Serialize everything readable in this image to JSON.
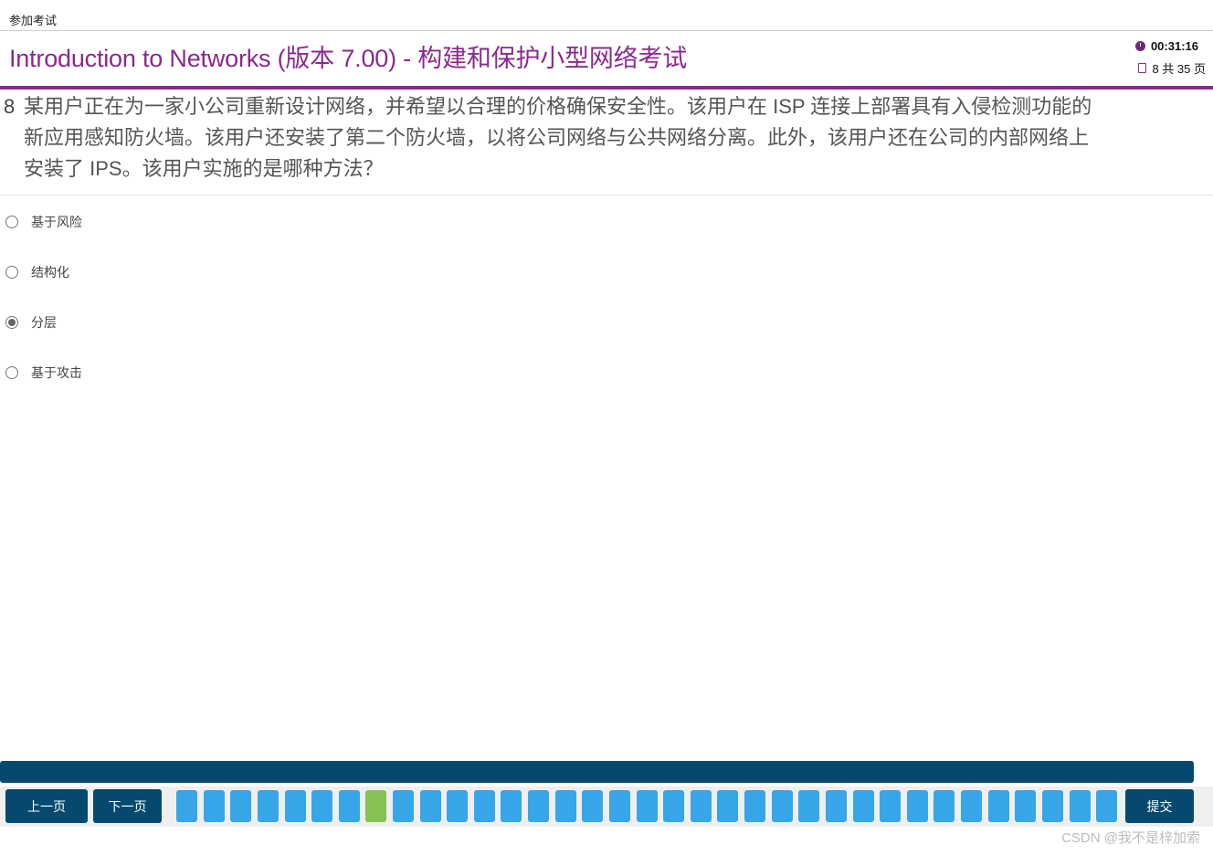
{
  "topbar": {
    "breadcrumb": "参加考试"
  },
  "header": {
    "title": "Introduction to Networks (版本 7.00) - 构建和保护小型网络考试",
    "timer": "00:31:16",
    "page_indicator": "8 共 35 页"
  },
  "question": {
    "number": "8",
    "text": "某用户正在为一家小公司重新设计网络，并希望以合理的价格确保安全性。该用户在 ISP 连接上部署具有入侵检测功能的新应用感知防火墙。该用户还安装了第二个防火墙，以将公司网络与公共网络分离。此外，该用户还在公司的内部网络上安装了 IPS。该用户实施的是哪种方法？"
  },
  "options": [
    {
      "label": "基于风险",
      "selected": false
    },
    {
      "label": "结构化",
      "selected": false
    },
    {
      "label": "分层",
      "selected": true
    },
    {
      "label": "基于攻击",
      "selected": false
    }
  ],
  "nav": {
    "prev_label": "上一页",
    "next_label": "下一页",
    "submit_label": "提交",
    "question_count": 35,
    "current_question": 8,
    "colors": {
      "answered": "#36a6e8",
      "current": "#86c154",
      "button": "#054a6e"
    }
  },
  "watermark": "CSDN @我不是梓加索"
}
